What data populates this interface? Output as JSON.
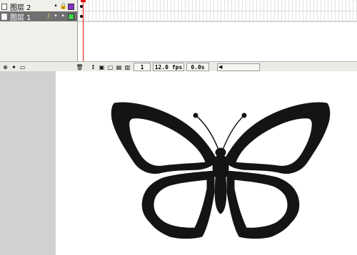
{
  "layers": [
    {
      "name": "图层 2",
      "color": "#8b2fc9",
      "active": false
    },
    {
      "name": "图层 1",
      "color": "#3fd24a",
      "active": true
    }
  ],
  "header_glyphs": {
    "eye": "•",
    "lock": "🔒",
    "outline": "□",
    "pencil": "✎",
    "dot": "•"
  },
  "toolbar": {
    "frame_number": "1",
    "fps": "12.0 fps",
    "elapsed": "0.0s"
  },
  "colors": {
    "playhead": "#e01010",
    "active_layer_bg": "#6f6f6f",
    "stage_bg": "#ffffff",
    "pasteboard": "#d1d1d1"
  },
  "icons": [
    "insert-layer-icon",
    "add-motion-guide-icon",
    "insert-folder-icon",
    "delete-layer-icon",
    "center-frame-icon",
    "onion-skin-icon",
    "onion-outline-icon",
    "edit-multiple-frames-icon",
    "modify-onion-markers-icon",
    "butterfly-shape"
  ]
}
